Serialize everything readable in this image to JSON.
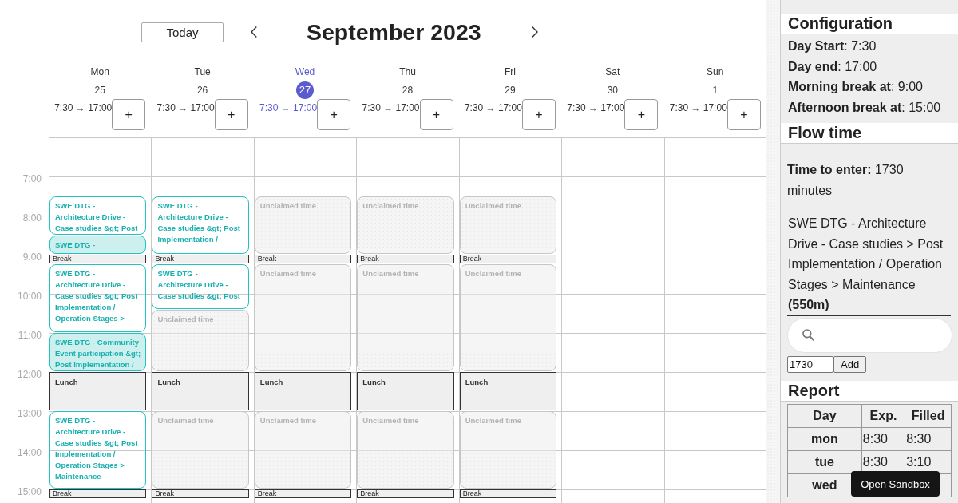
{
  "calendar": {
    "today_button": "Today",
    "title": "September 2023",
    "time_labels": [
      "7:00",
      "8:00",
      "9:00",
      "10:00",
      "11:00",
      "12:00",
      "13:00",
      "14:00",
      "15:00"
    ],
    "days": [
      {
        "name": "Mon",
        "date": "25",
        "hours": "7:30 → 17:00",
        "add_button": "+",
        "today": false,
        "events": [
          {
            "kind": "task",
            "filled": false,
            "label": "SWE DTG - Architecture Drive - Case studies &gt; Post"
          },
          {
            "kind": "task",
            "filled": true,
            "label": "SWE DTG -"
          },
          {
            "kind": "break",
            "label": "Break"
          },
          {
            "kind": "task",
            "filled": false,
            "label": "SWE DTG - Architecture Drive - Case studies &gt; Post Implementation / Operation Stages >"
          },
          {
            "kind": "task",
            "filled": true,
            "label": "SWE DTG - Community Event participation &gt; Post Implementation /"
          },
          {
            "kind": "lunch",
            "label": "Lunch"
          },
          {
            "kind": "task",
            "filled": false,
            "label": "SWE DTG - Architecture Drive - Case studies &gt; Post Implementation / Operation Stages > Maintenance"
          },
          {
            "kind": "break",
            "label": "Break"
          }
        ]
      },
      {
        "name": "Tue",
        "date": "26",
        "hours": "7:30 → 17:00",
        "add_button": "+",
        "today": false,
        "events": [
          {
            "kind": "task",
            "filled": false,
            "label": "SWE DTG - Architecture Drive - Case studies &gt; Post Implementation /"
          },
          {
            "kind": "break",
            "label": "Break"
          },
          {
            "kind": "task",
            "filled": false,
            "label": "SWE DTG - Architecture Drive - Case studies &gt; Post"
          },
          {
            "kind": "unclaimed",
            "label": "Unclaimed time"
          },
          {
            "kind": "lunch",
            "label": "Lunch"
          },
          {
            "kind": "unclaimed",
            "label": "Unclaimed time"
          },
          {
            "kind": "break",
            "label": "Break"
          }
        ]
      },
      {
        "name": "Wed",
        "date": "27",
        "hours": "7:30 → 17:00",
        "add_button": "+",
        "today": true,
        "events": [
          {
            "kind": "unclaimed",
            "label": "Unclaimed time"
          },
          {
            "kind": "break",
            "label": "Break"
          },
          {
            "kind": "unclaimed",
            "label": "Unclaimed time"
          },
          {
            "kind": "lunch",
            "label": "Lunch"
          },
          {
            "kind": "unclaimed",
            "label": "Unclaimed time"
          },
          {
            "kind": "break",
            "label": "Break"
          }
        ]
      },
      {
        "name": "Thu",
        "date": "28",
        "hours": "7:30 → 17:00",
        "add_button": "+",
        "today": false,
        "events": [
          {
            "kind": "unclaimed",
            "label": "Unclaimed time"
          },
          {
            "kind": "break",
            "label": "Break"
          },
          {
            "kind": "unclaimed",
            "label": "Unclaimed time"
          },
          {
            "kind": "lunch",
            "label": "Lunch"
          },
          {
            "kind": "unclaimed",
            "label": "Unclaimed time"
          },
          {
            "kind": "break",
            "label": "Break"
          }
        ]
      },
      {
        "name": "Fri",
        "date": "29",
        "hours": "7:30 → 17:00",
        "add_button": "+",
        "today": false,
        "events": [
          {
            "kind": "unclaimed",
            "label": "Unclaimed time"
          },
          {
            "kind": "break",
            "label": "Break"
          },
          {
            "kind": "unclaimed",
            "label": "Unclaimed time"
          },
          {
            "kind": "lunch",
            "label": "Lunch"
          },
          {
            "kind": "unclaimed",
            "label": "Unclaimed time"
          },
          {
            "kind": "break",
            "label": "Break"
          }
        ]
      },
      {
        "name": "Sat",
        "date": "30",
        "hours": "7:30 → 17:00",
        "add_button": "+",
        "today": false
      },
      {
        "name": "Sun",
        "date": "1",
        "hours": "7:30 → 17:00",
        "add_button": "+",
        "today": false
      }
    ]
  },
  "configuration": {
    "title": "Configuration",
    "lines": [
      "**Day Start**: 7:30",
      "**Day end**: 17:00",
      "**Morning break at**: 9:00",
      "**Afternoon break at**: 15:00"
    ]
  },
  "flow_time": {
    "title": "Flow time",
    "time_to_enter": "**Time to enter:** 1730 minutes",
    "current_task": "SWE DTG - Architecture Drive - Case studies > Post Implementation / Operation Stages > Maintenance **(550m)**",
    "minutes_input": {
      "value": "1730"
    },
    "add_button": "Add"
  },
  "report": {
    "title": "Report",
    "columns": [
      "Day",
      "Exp.",
      "Filled"
    ],
    "rows": [
      {
        "day": "mon",
        "expected": "8:30",
        "filled": "8:30"
      },
      {
        "day": "tue",
        "expected": "8:30",
        "filled": "3:10"
      },
      {
        "day": "wed"
      }
    ]
  },
  "open_sandbox_button": "Open Sandbox"
}
